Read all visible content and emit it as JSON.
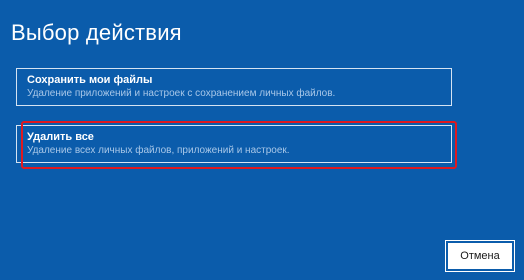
{
  "page": {
    "title": "Выбор действия"
  },
  "options": [
    {
      "name": "Сохранить мои файлы",
      "description": "Удаление приложений и настроек с сохранением личных файлов."
    },
    {
      "name": "Удалить все",
      "description": "Удаление всех личных файлов, приложений и настроек."
    }
  ],
  "footer": {
    "cancel_label": "Отмена"
  },
  "colors": {
    "background": "#0b5cab",
    "highlight": "#e0191f",
    "option_border": "#d5e3f2",
    "description_text": "#a8c7e8"
  }
}
